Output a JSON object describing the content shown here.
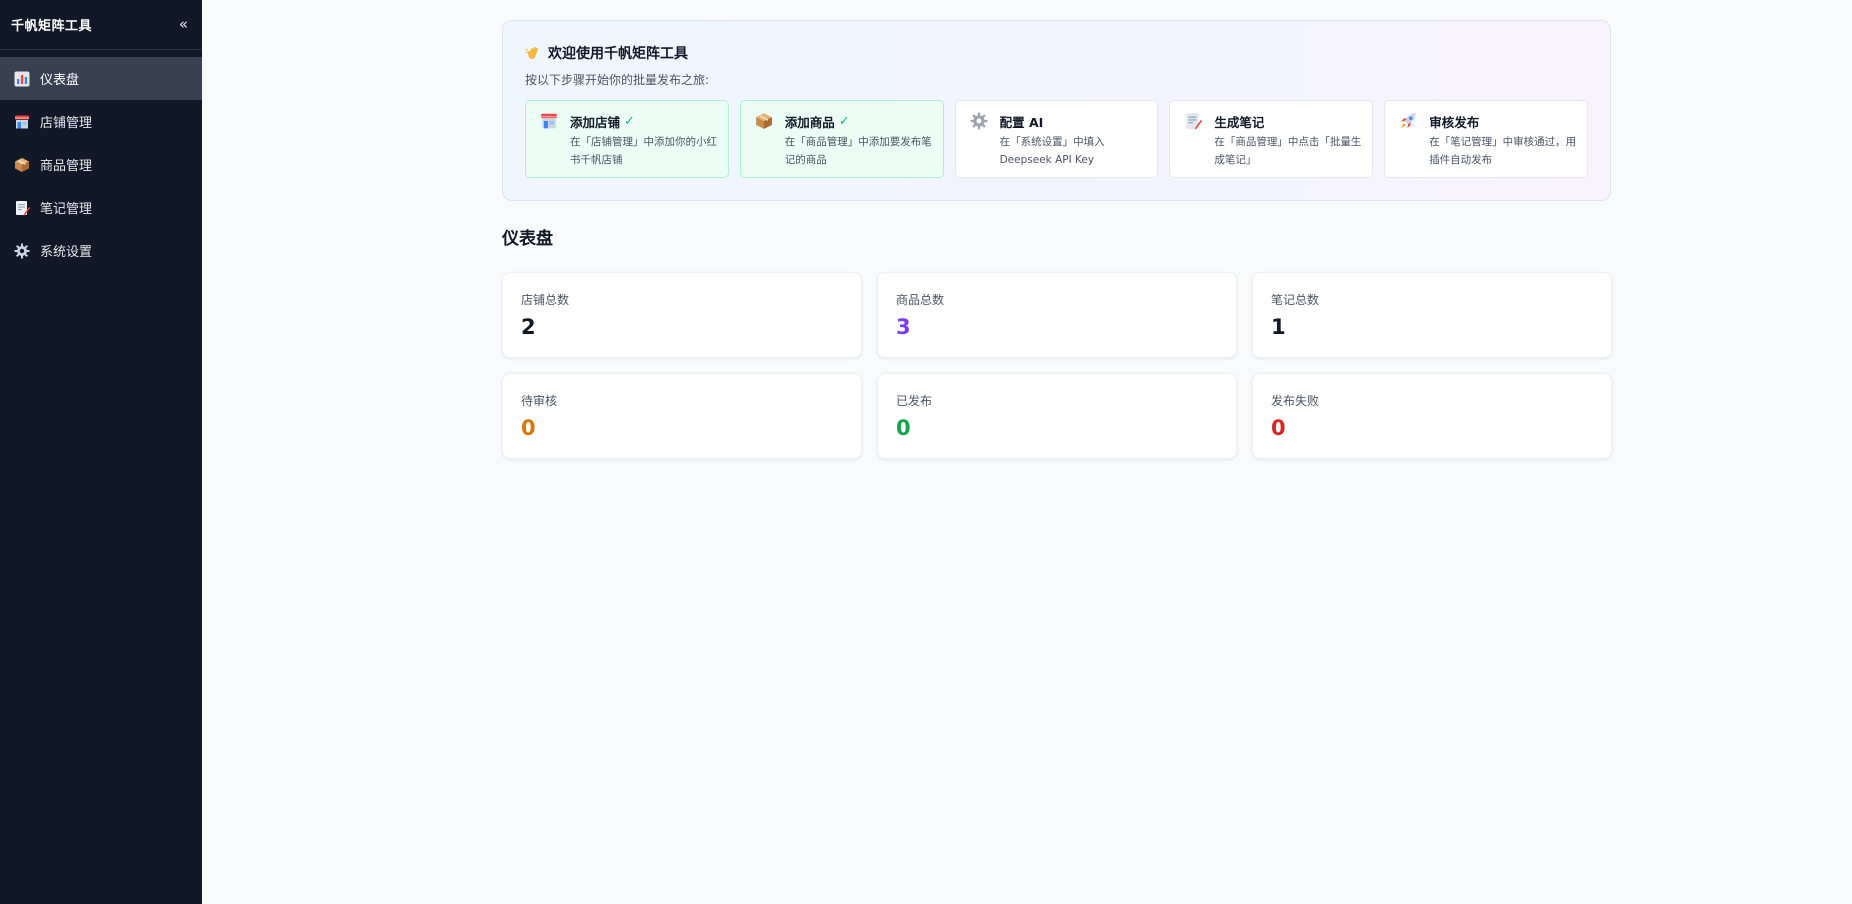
{
  "sidebar": {
    "title": "千帆矩阵工具",
    "collapse": "«",
    "items": [
      {
        "label": "仪表盘",
        "icon": "bar-chart-icon",
        "active": true
      },
      {
        "label": "店铺管理",
        "icon": "store-icon"
      },
      {
        "label": "商品管理",
        "icon": "package-icon"
      },
      {
        "label": "笔记管理",
        "icon": "note-icon"
      },
      {
        "label": "系统设置",
        "icon": "gear-icon"
      }
    ]
  },
  "welcome": {
    "title": "欢迎使用千帆矩阵工具",
    "subtitle": "按以下步骤开始你的批量发布之旅:",
    "check": "✓",
    "steps": [
      {
        "title": "添加店铺",
        "desc": "在「店铺管理」中添加你的小红书千帆店铺",
        "done": true,
        "icon": "store-icon"
      },
      {
        "title": "添加商品",
        "desc": "在「商品管理」中添加要发布笔记的商品",
        "done": true,
        "icon": "package-icon"
      },
      {
        "title": "配置 AI",
        "desc": "在「系统设置」中填入 Deepseek API Key",
        "done": false,
        "icon": "gear-icon"
      },
      {
        "title": "生成笔记",
        "desc": "在「商品管理」中点击「批量生成笔记」",
        "done": false,
        "icon": "note-icon"
      },
      {
        "title": "审核发布",
        "desc": "在「笔记管理」中审核通过，用插件自动发布",
        "done": false,
        "icon": "rocket-icon"
      }
    ]
  },
  "dashboard": {
    "title": "仪表盘",
    "stats": [
      {
        "label": "店铺总数",
        "value": "2",
        "color": "#111827"
      },
      {
        "label": "商品总数",
        "value": "3",
        "color": "#7c3aed"
      },
      {
        "label": "笔记总数",
        "value": "1",
        "color": "#111827"
      },
      {
        "label": "待审核",
        "value": "0",
        "color": "#d97706"
      },
      {
        "label": "已发布",
        "value": "0",
        "color": "#16a34a"
      },
      {
        "label": "发布失败",
        "value": "0",
        "color": "#dc2626"
      }
    ]
  }
}
